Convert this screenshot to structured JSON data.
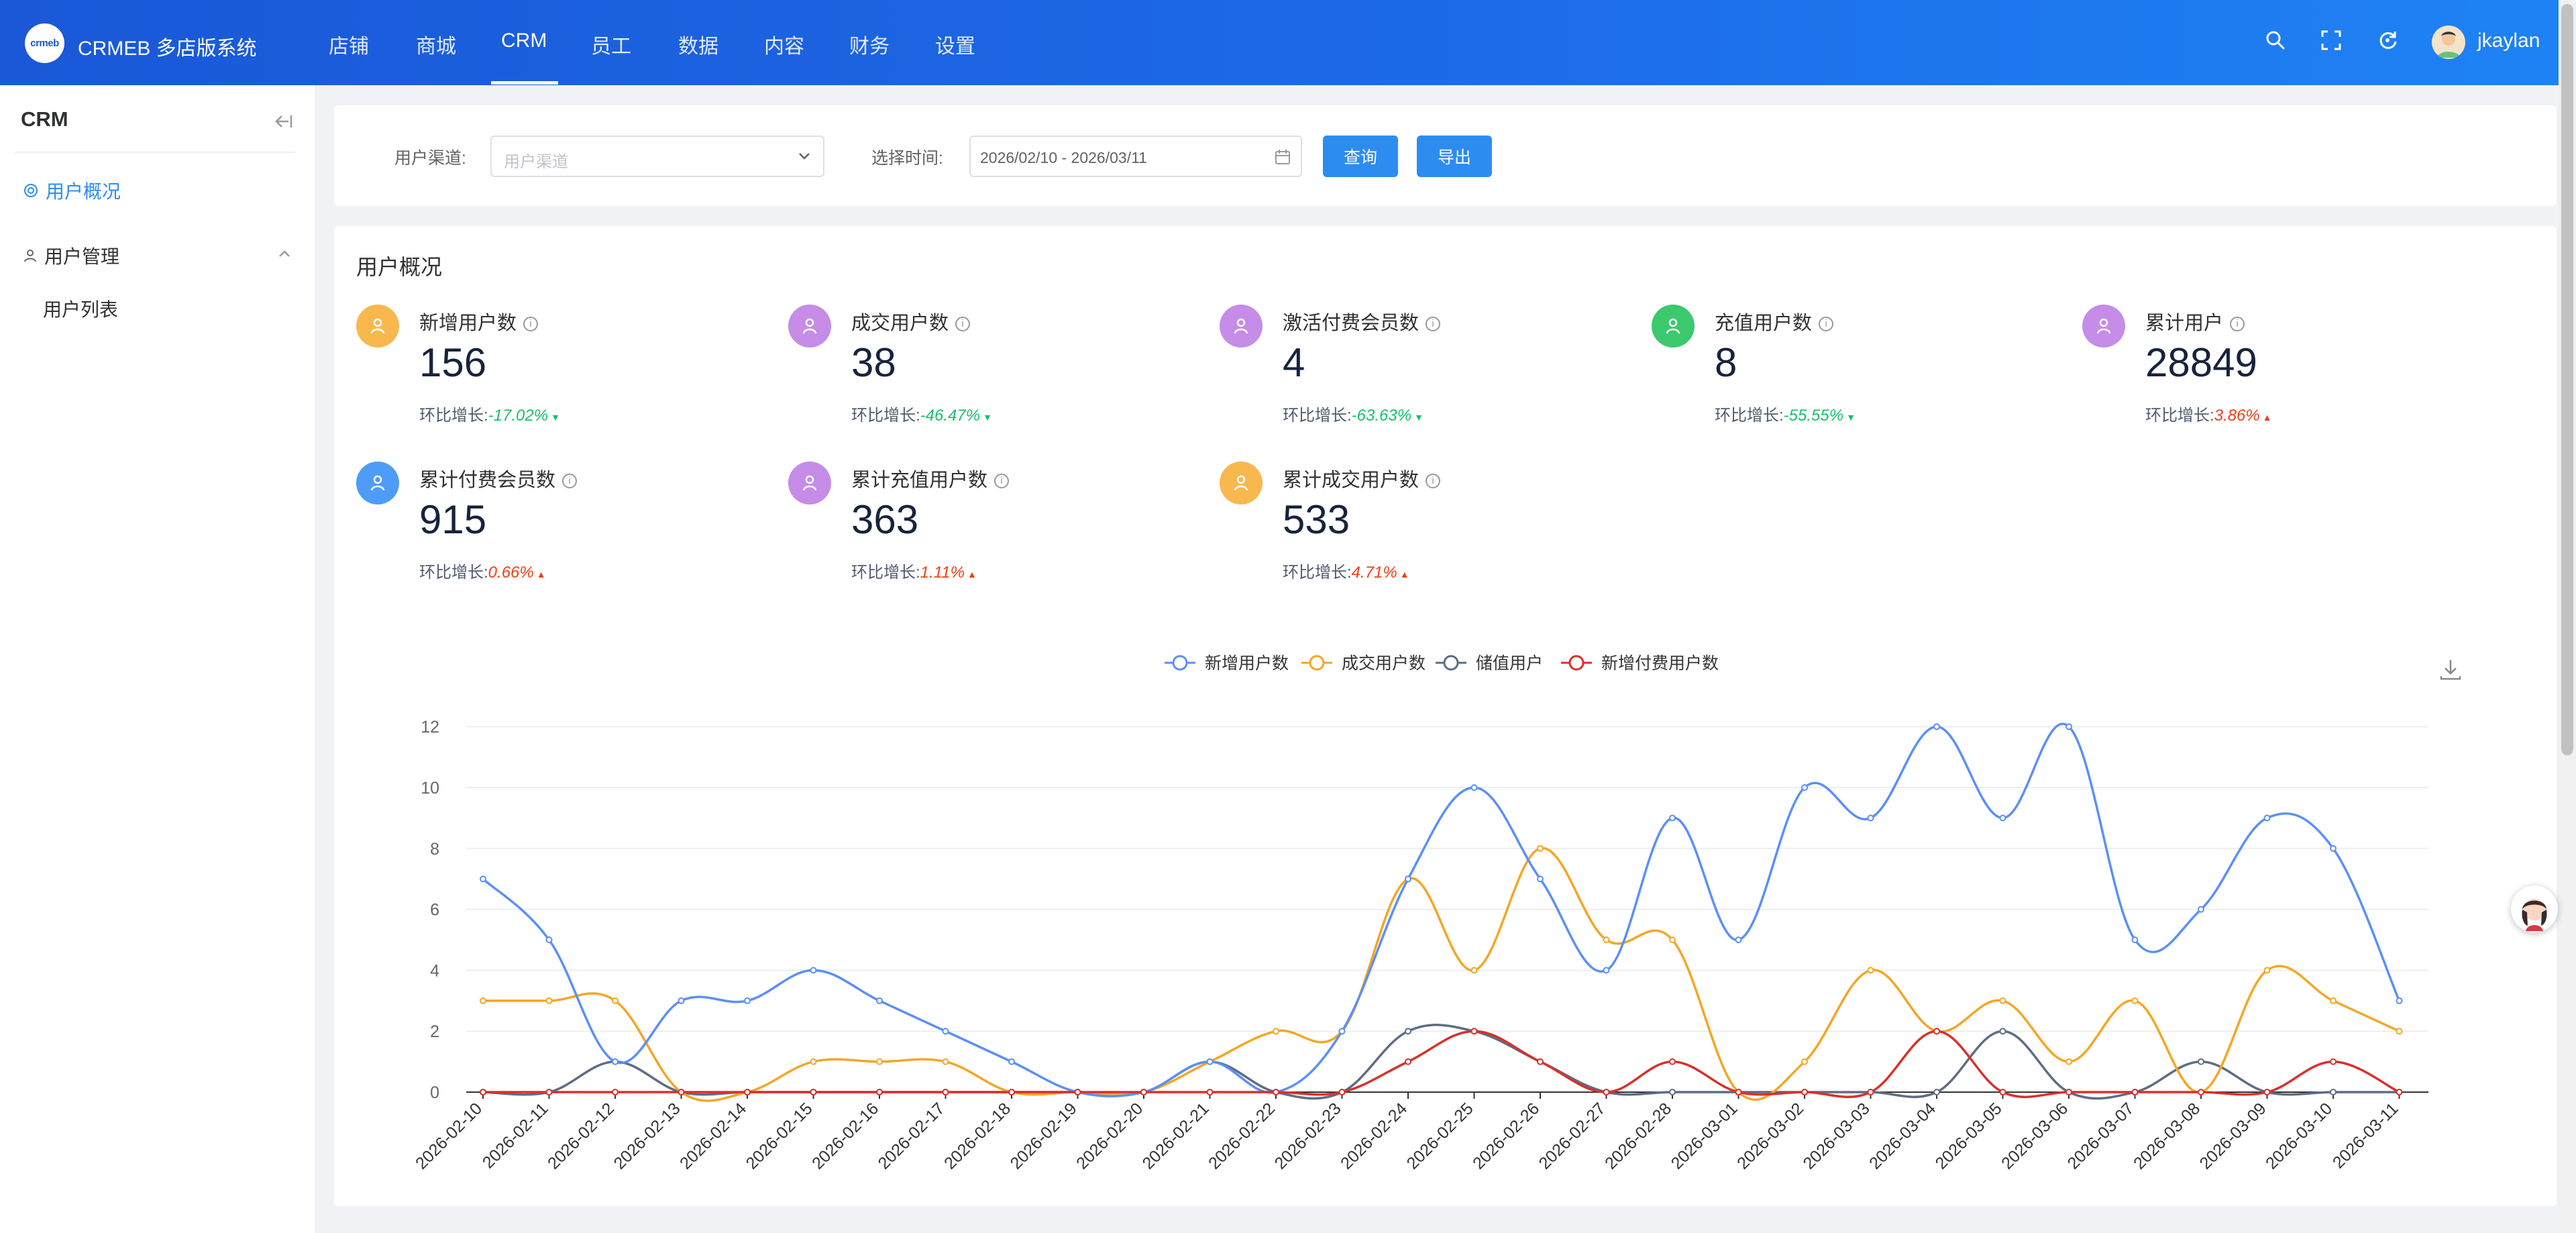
{
  "header": {
    "logo_text": "crmeb",
    "app_title": "CRMEB 多店版系统",
    "nav": [
      "店铺",
      "商城",
      "CRM",
      "员工",
      "数据",
      "内容",
      "财务",
      "设置"
    ],
    "active_nav": "CRM",
    "username": "jkaylan"
  },
  "sidebar": {
    "title": "CRM",
    "items": [
      {
        "label": "用户概况",
        "active": true
      },
      {
        "label": "用户管理"
      },
      {
        "label": "用户列表"
      }
    ]
  },
  "filter": {
    "channel_label": "用户渠道:",
    "channel_placeholder": "用户渠道",
    "time_label": "选择时间:",
    "date_range": "2026/02/10 - 2026/03/11",
    "query_button": "查询",
    "export_button": "导出"
  },
  "overview": {
    "title": "用户概况",
    "change_label": "环比增长:",
    "stats": [
      {
        "label": "新增用户数",
        "value": "156",
        "change": "-17.02%",
        "trend": "down",
        "color": "#f8b84e"
      },
      {
        "label": "成交用户数",
        "value": "38",
        "change": "-46.47%",
        "trend": "down",
        "color": "#c58ce8"
      },
      {
        "label": "激活付费会员数",
        "value": "4",
        "change": "-63.63%",
        "trend": "down",
        "color": "#c58ce8"
      },
      {
        "label": "充值用户数",
        "value": "8",
        "change": "-55.55%",
        "trend": "down",
        "color": "#3cc96e"
      },
      {
        "label": "累计用户",
        "value": "28849",
        "change": "3.86%",
        "trend": "up",
        "color": "#c58ce8"
      },
      {
        "label": "累计付费会员数",
        "value": "915",
        "change": "0.66%",
        "trend": "up",
        "color": "#4e9cf7"
      },
      {
        "label": "累计充值用户数",
        "value": "363",
        "change": "1.11%",
        "trend": "up",
        "color": "#c58ce8"
      },
      {
        "label": "累计成交用户数",
        "value": "533",
        "change": "4.71%",
        "trend": "up",
        "color": "#f8b84e"
      }
    ]
  },
  "chart_data": {
    "type": "line",
    "smooth": true,
    "legend_position": "top-center",
    "ylim": [
      0,
      12
    ],
    "yticks": [
      0,
      2,
      4,
      6,
      8,
      10,
      12
    ],
    "grid": true,
    "x": [
      "2026-02-10",
      "2026-02-11",
      "2026-02-12",
      "2026-02-13",
      "2026-02-14",
      "2026-02-15",
      "2026-02-16",
      "2026-02-17",
      "2026-02-18",
      "2026-02-19",
      "2026-02-20",
      "2026-02-21",
      "2026-02-22",
      "2026-02-23",
      "2026-02-24",
      "2026-02-25",
      "2026-02-26",
      "2026-02-27",
      "2026-02-28",
      "2026-03-01",
      "2026-03-02",
      "2026-03-03",
      "2026-03-04",
      "2026-03-05",
      "2026-03-06",
      "2026-03-07",
      "2026-03-08",
      "2026-03-09",
      "2026-03-10",
      "2026-03-11"
    ],
    "series": [
      {
        "name": "新增用户数",
        "color": "#5b8ff9",
        "values": [
          7,
          5,
          1,
          3,
          3,
          4,
          3,
          2,
          1,
          0,
          0,
          1,
          0,
          2,
          7,
          10,
          7,
          4,
          9,
          5,
          10,
          9,
          12,
          9,
          12,
          5,
          6,
          9,
          8,
          3
        ]
      },
      {
        "name": "成交用户数",
        "color": "#f5a623",
        "values": [
          3,
          3,
          3,
          0,
          0,
          1,
          1,
          1,
          0,
          0,
          0,
          1,
          2,
          2,
          7,
          4,
          8,
          5,
          5,
          0,
          1,
          4,
          2,
          3,
          1,
          3,
          0,
          4,
          3,
          2
        ]
      },
      {
        "name": "储值用户",
        "color": "#5d6d84",
        "values": [
          0,
          0,
          1,
          0,
          0,
          0,
          0,
          0,
          0,
          0,
          0,
          1,
          0,
          0,
          2,
          2,
          1,
          0,
          0,
          0,
          0,
          0,
          0,
          2,
          0,
          0,
          1,
          0,
          0,
          0
        ]
      },
      {
        "name": "新增付费用户数",
        "color": "#d9302c",
        "values": [
          0,
          0,
          0,
          0,
          0,
          0,
          0,
          0,
          0,
          0,
          0,
          0,
          0,
          0,
          1,
          2,
          1,
          0,
          1,
          0,
          0,
          0,
          2,
          0,
          0,
          0,
          0,
          0,
          1,
          0
        ]
      }
    ]
  }
}
